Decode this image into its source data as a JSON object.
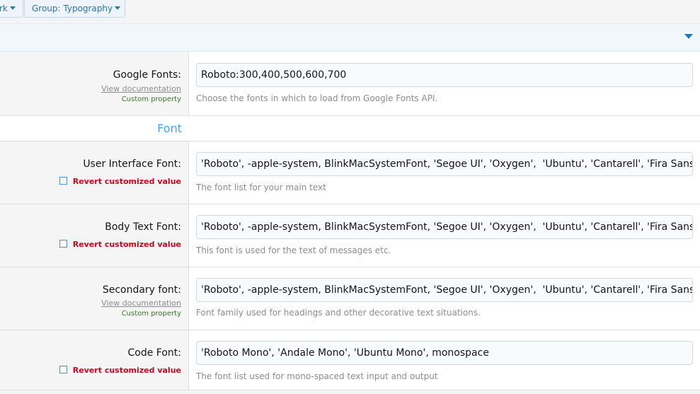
{
  "toolbar": {
    "left_button_label": "rk",
    "group_button_label": "Group: Typography"
  },
  "rows": {
    "google_fonts": {
      "label": "Google Fonts:",
      "doc_link": "View documentation",
      "custom_property": "Custom property",
      "value": "Roboto:300,400,500,600,700",
      "hint": "Choose the fonts in which to load from Google Fonts API."
    },
    "ui_font": {
      "label": "User Interface Font:",
      "revert": "Revert customized value",
      "value": "'Roboto', -apple-system, BlinkMacSystemFont, 'Segoe UI', 'Oxygen',  'Ubuntu', 'Cantarell', 'Fira Sans',     '[",
      "hint": "The font list for your main text"
    },
    "body_font": {
      "label": "Body Text Font:",
      "revert": "Revert customized value",
      "value": "'Roboto', -apple-system, BlinkMacSystemFont, 'Segoe UI', 'Oxygen',  'Ubuntu', 'Cantarell', 'Fira Sans',     '[",
      "hint": "This font is used for the text of messages etc."
    },
    "secondary_font": {
      "label": "Secondary font:",
      "doc_link": "View documentation",
      "custom_property": "Custom property",
      "value": "'Roboto', -apple-system, BlinkMacSystemFont, 'Segoe UI', 'Oxygen',  'Ubuntu', 'Cantarell', 'Fira Sans',     '[",
      "hint": "Font family used for headings and other decorative text situations."
    },
    "code_font": {
      "label": "Code Font:",
      "revert": "Revert customized value",
      "value": "'Roboto Mono', 'Andale Mono', 'Ubuntu Mono', monospace",
      "hint": "The font list used for mono-spaced text input and output"
    }
  },
  "subheading": "Font",
  "icons": {
    "dropdown": "caret-down-icon",
    "collapse": "collapse-caret-icon",
    "revert_checkbox": "checkbox-icon"
  },
  "colors": {
    "link_blue": "#2577b1",
    "heading_blue": "#47a7eb",
    "revert_red": "#d0021b",
    "custom_green": "#3b7a25"
  }
}
